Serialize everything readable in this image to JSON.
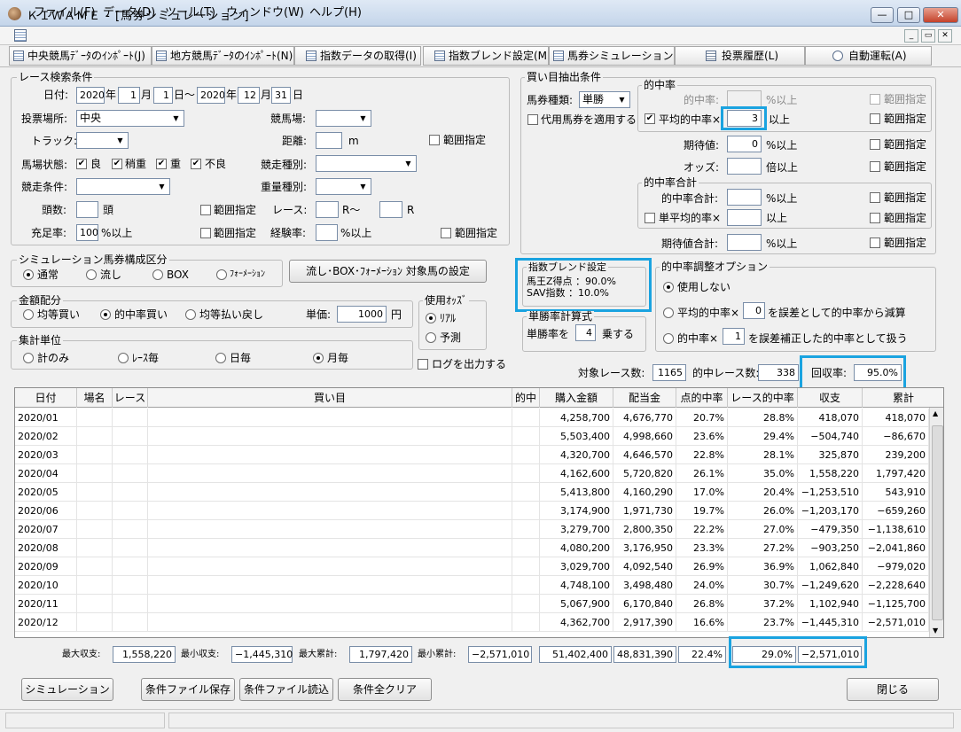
{
  "window": {
    "title": "ＫＩＷＡＭＥ - [馬券シミュレーション]",
    "minimize": "—",
    "maximize": "□",
    "close": "✕"
  },
  "menu": [
    "ファイル(F)",
    "データ(D)",
    "ツール(T)",
    "ウィンドウ(W)",
    "ヘルプ(H)"
  ],
  "mdi": {
    "min": "_",
    "restore": "▭",
    "close": "✕"
  },
  "toolbar": [
    "中央競馬ﾃﾞｰﾀのｲﾝﾎﾟｰﾄ(J)",
    "地方競馬ﾃﾞｰﾀのｲﾝﾎﾟｰﾄ(N)",
    "指数データの取得(I)",
    "指数ブレンド設定(M)",
    "馬券シミュレーション(B)",
    "投票履歴(L)",
    "自動運転(A)"
  ],
  "race": {
    "group": "レース検索条件",
    "date_label": "日付:",
    "y1": "2020",
    "m1": "1",
    "d1": "1",
    "y2": "2020",
    "m2": "12",
    "d2": "31",
    "u_year": "年",
    "u_month": "月",
    "u_day_from": "日～",
    "u_day": "日",
    "place_label": "投票場所:",
    "place": "中央",
    "track_label": "競馬場:",
    "trk_label": "トラック:",
    "dist_label": "距離:",
    "dist_unit": "m",
    "range": "範囲指定",
    "cond_label": "馬場状態:",
    "c1": "良",
    "c2": "稍重",
    "c3": "重",
    "c4": "不良",
    "type_label": "競走種別:",
    "kcond_label": "競走条件:",
    "weight_label": "重量種別:",
    "heads_label": "頭数:",
    "heads_unit": "頭",
    "races_label": "レース:",
    "races_unit1": "R～",
    "races_unit2": "R",
    "fill_label": "充足率:",
    "fill": "100",
    "fill_unit": "%以上",
    "exp_label": "経験率:",
    "exp_unit": "%以上"
  },
  "sim": {
    "group": "シミュレーション馬券構成区分",
    "r1": "通常",
    "r2": "流し",
    "r3": "BOX",
    "r4": "ﾌｫｰﾒｰｼｮﾝ",
    "btn": "流し･BOX･ﾌｫｰﾒｰｼｮﾝ 対象馬の設定"
  },
  "money": {
    "group": "金額配分",
    "r1": "均等買い",
    "r2": "的中率買い",
    "r3": "均等払い戻し",
    "price_label": "単価:",
    "price": "1000",
    "unit": "円"
  },
  "agg": {
    "group": "集計単位",
    "r1": "計のみ",
    "r2": "ﾚｰｽ毎",
    "r3": "日毎",
    "r4": "月毎"
  },
  "odds": {
    "group": "使用ｵｯｽﾞ",
    "r1": "ﾘｱﾙ",
    "r2": "予測"
  },
  "log_label": "ログを出力する",
  "buy": {
    "group": "買い目抽出条件",
    "type_label": "馬券種類:",
    "type": "単勝",
    "sub": "代用馬券を適用する",
    "hit_group": "的中率",
    "hit_label": "的中率:",
    "unit_pct": "%以上",
    "avg_label": "平均的中率×",
    "avg": "3",
    "unit_over": "以上",
    "exp_label": "期待値:",
    "exp": "0",
    "odds_label": "オッズ:",
    "odds_unit": "倍以上",
    "sum_group": "的中率合計",
    "sum_label": "的中率合計:",
    "savg_label": "単平均的率×",
    "expsum_label": "期待値合計:",
    "range": "範囲指定"
  },
  "blend": {
    "group": "指数ブレンド設定",
    "line1": "馬王Z得点 ：90.0%",
    "line2": "SAV指数 ：10.0%"
  },
  "tansho": {
    "group": "単勝率計算式",
    "label": "単勝率を",
    "value": "4",
    "unit": "乗する"
  },
  "adj": {
    "group": "的中率調整オプション",
    "r1": "使用しない",
    "r2a": "平均的中率×",
    "r2v": "0",
    "r2b": "を誤差として的中率から減算",
    "r3a": "的中率×",
    "r3v": "1",
    "r3b": "を誤差補正した的中率として扱う"
  },
  "summary": {
    "races_label": "対象レース数:",
    "races": "1165",
    "hits_label": "的中レース数:",
    "hits": "338",
    "recovery_label": "回収率:",
    "recovery": "95.0%"
  },
  "table": {
    "headers": [
      "日付",
      "場名",
      "レース",
      "買い目",
      "的中",
      "購入金額",
      "配当金",
      "点的中率",
      "レース的中率",
      "収支",
      "累計"
    ],
    "rows": [
      [
        "2020/01",
        "",
        "",
        "",
        "",
        "4,258,700",
        "4,676,770",
        "20.7%",
        "28.8%",
        "418,070",
        "418,070"
      ],
      [
        "2020/02",
        "",
        "",
        "",
        "",
        "5,503,400",
        "4,998,660",
        "23.6%",
        "29.4%",
        "−504,740",
        "−86,670"
      ],
      [
        "2020/03",
        "",
        "",
        "",
        "",
        "4,320,700",
        "4,646,570",
        "22.8%",
        "28.1%",
        "325,870",
        "239,200"
      ],
      [
        "2020/04",
        "",
        "",
        "",
        "",
        "4,162,600",
        "5,720,820",
        "26.1%",
        "35.0%",
        "1,558,220",
        "1,797,420"
      ],
      [
        "2020/05",
        "",
        "",
        "",
        "",
        "5,413,800",
        "4,160,290",
        "17.0%",
        "20.4%",
        "−1,253,510",
        "543,910"
      ],
      [
        "2020/06",
        "",
        "",
        "",
        "",
        "3,174,900",
        "1,971,730",
        "19.7%",
        "26.0%",
        "−1,203,170",
        "−659,260"
      ],
      [
        "2020/07",
        "",
        "",
        "",
        "",
        "3,279,700",
        "2,800,350",
        "22.2%",
        "27.0%",
        "−479,350",
        "−1,138,610"
      ],
      [
        "2020/08",
        "",
        "",
        "",
        "",
        "4,080,200",
        "3,176,950",
        "23.3%",
        "27.2%",
        "−903,250",
        "−2,041,860"
      ],
      [
        "2020/09",
        "",
        "",
        "",
        "",
        "3,029,700",
        "4,092,540",
        "26.9%",
        "36.9%",
        "1,062,840",
        "−979,020"
      ],
      [
        "2020/10",
        "",
        "",
        "",
        "",
        "4,748,100",
        "3,498,480",
        "24.0%",
        "30.7%",
        "−1,249,620",
        "−2,228,640"
      ],
      [
        "2020/11",
        "",
        "",
        "",
        "",
        "5,067,900",
        "6,170,840",
        "26.8%",
        "37.2%",
        "1,102,940",
        "−1,125,700"
      ],
      [
        "2020/12",
        "",
        "",
        "",
        "",
        "4,362,700",
        "2,917,390",
        "16.6%",
        "23.7%",
        "−1,445,310",
        "−2,571,010"
      ]
    ]
  },
  "totals": {
    "max_label": "最大収支:",
    "max": "1,558,220",
    "min_label": "最小収支:",
    "min": "−1,445,310",
    "maxc_label": "最大累計:",
    "maxc": "1,797,420",
    "minc_label": "最小累計:",
    "minc": "−2,571,010",
    "buy": "51,402,400",
    "pay": "48,831,390",
    "pt": "22.4%",
    "race": "29.0%",
    "bal": "−2,571,010"
  },
  "buttons": {
    "sim": "シミュレーション",
    "save": "条件ファイル保存",
    "load": "条件ファイル読込",
    "clear": "条件全クリア",
    "close": "閉じる"
  },
  "scroll": {
    "up": "▲",
    "down": "▼"
  },
  "arrow": "▼",
  "check": "✔"
}
